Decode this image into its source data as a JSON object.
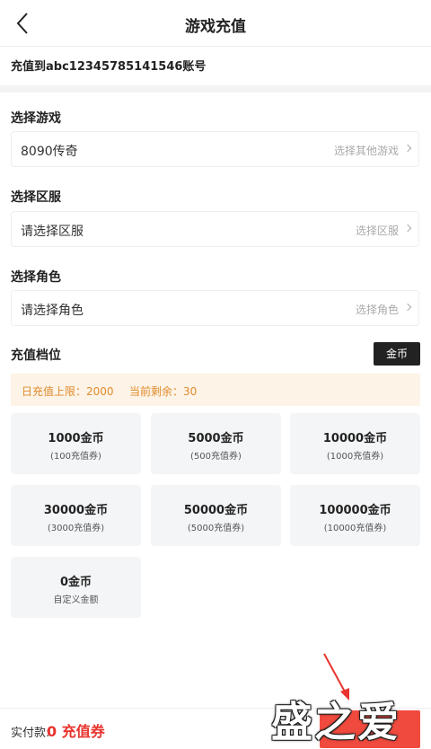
{
  "header": {
    "title": "游戏充值"
  },
  "account": {
    "text": "充值到abc12345785141546账号"
  },
  "game": {
    "label": "选择游戏",
    "value": "8090传奇",
    "hint": "选择其他游戏"
  },
  "server": {
    "label": "选择区服",
    "value": "请选择区服",
    "hint": "选择区服"
  },
  "role": {
    "label": "选择角色",
    "value": "请选择角色",
    "hint": "选择角色"
  },
  "tiers": {
    "label": "充值档位",
    "currency_button": "金币",
    "daily_limit": "日充值上限：2000",
    "remaining": "当前剩余：30",
    "items": [
      {
        "main": "1000金币",
        "sub": "(100充值券)"
      },
      {
        "main": "5000金币",
        "sub": "(500充值券)"
      },
      {
        "main": "10000金币",
        "sub": "(1000充值券)"
      },
      {
        "main": "30000金币",
        "sub": "(3000充值券)"
      },
      {
        "main": "50000金币",
        "sub": "(5000充值券)"
      },
      {
        "main": "100000金币",
        "sub": "(10000充值券)"
      },
      {
        "main": "0金币",
        "sub": "自定义金额"
      }
    ]
  },
  "footer": {
    "pay_label": "实付款:",
    "pay_amount": "0 充值券"
  },
  "watermark": {
    "text": "盛之爱"
  },
  "colors": {
    "accent": "#e8332e",
    "warning_text": "#e08b2d",
    "warning_bg": "#fdf3e6"
  }
}
